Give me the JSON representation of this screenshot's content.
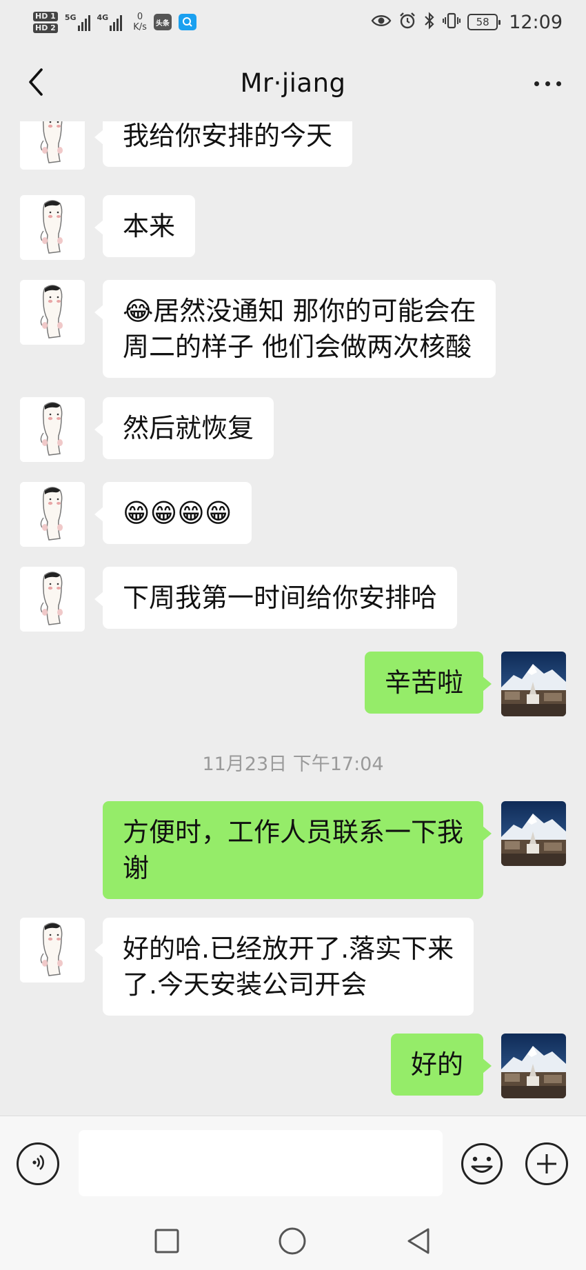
{
  "status_bar": {
    "sim1": "HD 1",
    "sim2": "HD 2",
    "net1": "5G",
    "net2": "4G",
    "speed_value": "0",
    "speed_unit": "K/s",
    "app_badge_toutiao": "头条",
    "battery": "58",
    "time": "12:09",
    "icons": [
      "eye-icon",
      "alarm-icon",
      "bluetooth-icon",
      "vibrate-icon",
      "battery-icon"
    ]
  },
  "header": {
    "title": "Mr·jiang",
    "back_icon": "chevron-left-icon",
    "more_icon": "more-icon"
  },
  "messages": [
    {
      "side": "left",
      "text": "我给你安排的今天"
    },
    {
      "side": "left",
      "text": "本来"
    },
    {
      "side": "left",
      "text": "😂居然没通知 那你的可能会在\n周二的样子 他们会做两次核酸"
    },
    {
      "side": "left",
      "text": "然后就恢复"
    },
    {
      "side": "left",
      "text": "😁😁😁😁"
    },
    {
      "side": "left",
      "text": "下周我第一时间给你安排哈"
    },
    {
      "side": "right",
      "text": "辛苦啦"
    },
    {
      "side": "right",
      "text": "方便时，工作人员联系一下我\n谢"
    },
    {
      "side": "left",
      "text": "好的哈.已经放开了.落实下来\n了.今天安装公司开会"
    },
    {
      "side": "right",
      "text": "好的"
    }
  ],
  "timestamp": "11月23日 下午17:04",
  "input_bar": {
    "placeholder": "",
    "voice_icon": "voice-icon",
    "emoji_icon": "emoji-icon",
    "plus_icon": "plus-icon"
  },
  "nav_bar": {
    "icons": [
      "recent-apps-icon",
      "home-icon",
      "back-icon"
    ]
  },
  "colors": {
    "background": "#ededed",
    "bubble_left": "#ffffff",
    "bubble_right": "#95ec69",
    "timestamp": "#9a9a9a"
  }
}
